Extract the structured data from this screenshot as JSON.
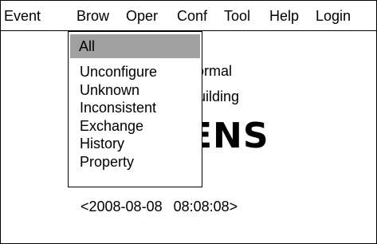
{
  "menubar": {
    "items": [
      "Event",
      "Brow",
      "Oper",
      "Conf",
      "Tool",
      "Help",
      "Login"
    ]
  },
  "background": {
    "line1": "normal",
    "line2": "Building",
    "brand": "ENS",
    "date": "<2008-08-08",
    "time": "08:08:08>"
  },
  "dropdown": {
    "selected": "All",
    "items": [
      "Unconfigure",
      "Unknown",
      "Inconsistent",
      "Exchange",
      "History",
      "Property"
    ]
  },
  "colors": {
    "highlight": "#a0a0a0",
    "border": "#000000",
    "background": "#ffffff"
  }
}
